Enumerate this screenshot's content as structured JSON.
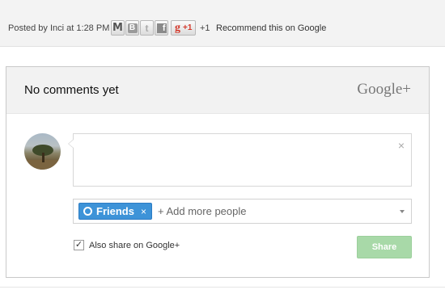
{
  "post_footer": {
    "posted_by": "Posted by Inci at",
    "time": "1:28 PM",
    "share_icons": {
      "mail": "M",
      "blog": "B",
      "twitter": "t",
      "facebook": "f"
    },
    "gplus_g": "g",
    "gplus_plus_one": "+1",
    "plus_count": "+1",
    "recommend": "Recommend this on Google"
  },
  "comments": {
    "header_title": "No comments yet",
    "brand": "Google+",
    "close_symbol": "×",
    "people": {
      "chip_label": "Friends",
      "chip_remove": "×",
      "placeholder": "+ Add more people"
    },
    "also_share_label": "Also share on Google+",
    "also_share_checked": "✓",
    "share_button": "Share"
  },
  "colors": {
    "chip_blue": "#3d93d8",
    "share_green": "#a8d9a8",
    "gplus_red": "#d3382b"
  }
}
